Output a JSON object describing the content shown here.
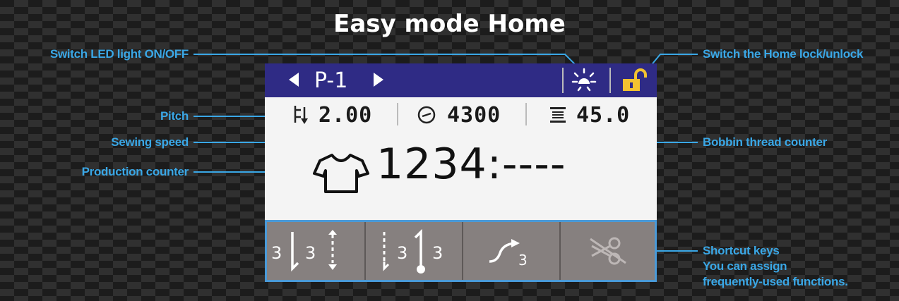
{
  "title": "Easy mode Home",
  "callouts": {
    "led": "Switch LED light ON/OFF",
    "lock": "Switch the Home lock/unlock",
    "pitch": "Pitch",
    "speed": "Sewing speed",
    "bobbin": "Bobbin thread counter",
    "production": "Production counter",
    "shortcut_line1": "Shortcut keys",
    "shortcut_line2": "You can assign",
    "shortcut_line3": "frequently-used functions."
  },
  "screen": {
    "program": "P-1",
    "pitch": "2.00",
    "speed": "4300",
    "bobbin": "45.0",
    "production": "1234:----",
    "shortcut_digits": [
      "3",
      "3",
      "3",
      "3",
      "3"
    ]
  },
  "colors": {
    "callout": "#3aa7e6",
    "topbar": "#2f2b85",
    "lock": "#f2c230",
    "shortcut_bg": "#86807f"
  },
  "icons": [
    "led-light-icon",
    "unlock-icon",
    "pitch-icon",
    "speed-icon",
    "bobbin-icon",
    "shirt-icon",
    "reverse-stitch-start-icon",
    "reverse-stitch-end-icon",
    "thread-trim-icon",
    "scissors-disabled-icon"
  ]
}
